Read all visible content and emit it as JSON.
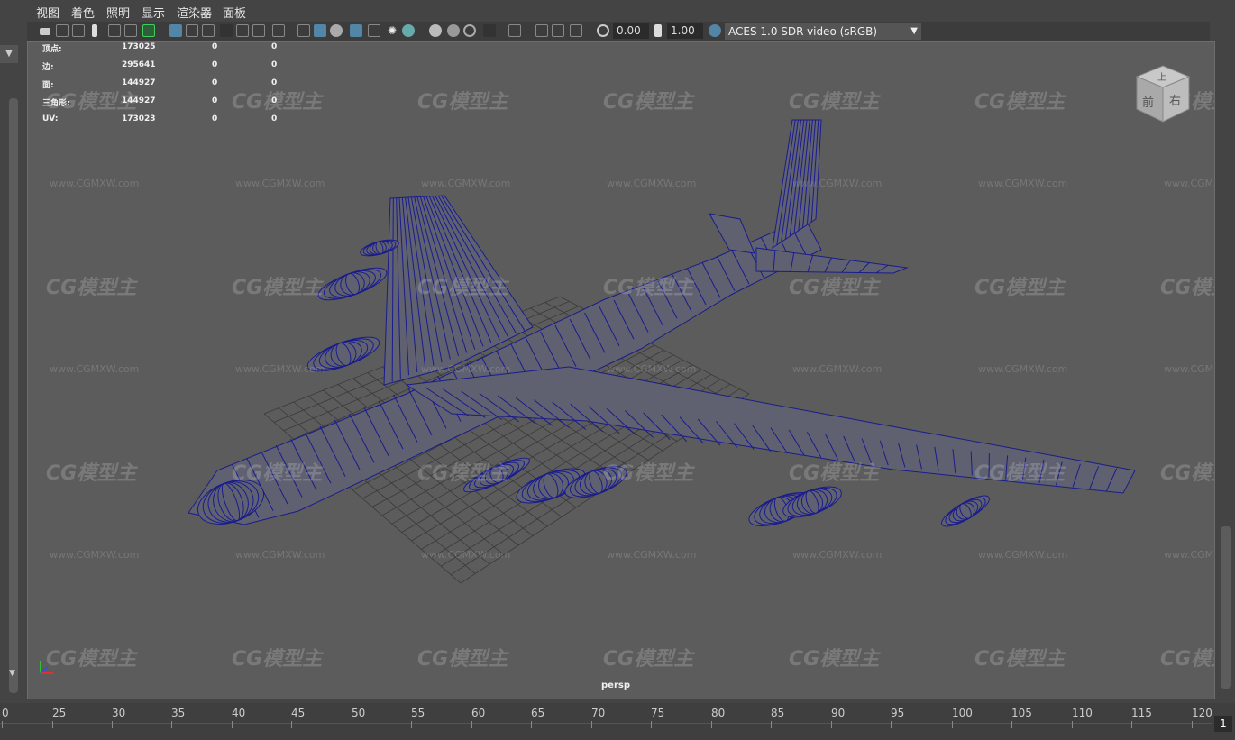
{
  "menu": [
    "视图",
    "着色",
    "照明",
    "显示",
    "渲染器",
    "面板"
  ],
  "toolbar": {
    "exposure_value": "0.00",
    "gamma_value": "1.00",
    "color_space": "ACES 1.0 SDR-video (sRGB)"
  },
  "hud": {
    "rows": [
      {
        "label": "顶点:",
        "total": "173025",
        "selected": "0",
        "components": "0"
      },
      {
        "label": "边:",
        "total": "295641",
        "selected": "0",
        "components": "0"
      },
      {
        "label": "面:",
        "total": "144927",
        "selected": "0",
        "components": "0"
      },
      {
        "label": "三角形:",
        "total": "144927",
        "selected": "0",
        "components": "0"
      },
      {
        "label": "UV:",
        "total": "173023",
        "selected": "0",
        "components": "0"
      }
    ]
  },
  "viewport": {
    "camera_label": "persp",
    "watermark_text": "CG模型主",
    "watermark_url": "www.CGMXW.com",
    "model": "wireframe-b52-bomber"
  },
  "viewcube": {
    "top_label": "上",
    "front_label": "前",
    "right_label": "右"
  },
  "timeline": {
    "ticks": [
      "0",
      "25",
      "30",
      "35",
      "40",
      "45",
      "50",
      "55",
      "60",
      "65",
      "70",
      "75",
      "80",
      "85",
      "90",
      "95",
      "100",
      "105",
      "110",
      "115",
      "120"
    ],
    "current_frame": "1"
  },
  "colors": {
    "wire": "#1a1c8c",
    "viewport_bg": "#5c5c5c",
    "active_tool": "#5285a6"
  }
}
